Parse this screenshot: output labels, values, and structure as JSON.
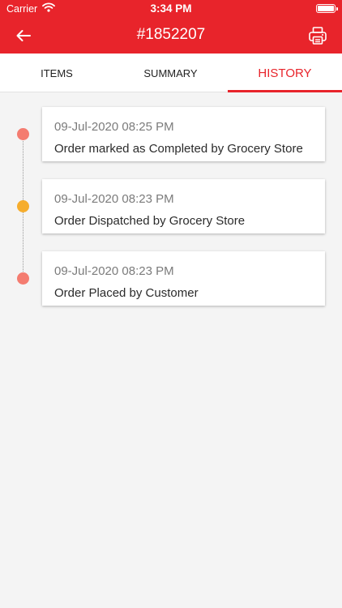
{
  "status_bar": {
    "carrier": "Carrier",
    "time": "3:34 PM"
  },
  "nav": {
    "title": "#1852207",
    "back_icon": "arrow-left-icon",
    "print_icon": "printer-icon"
  },
  "tabs": [
    {
      "label": "ITEMS",
      "active": false
    },
    {
      "label": "SUMMARY",
      "active": false
    },
    {
      "label": "HISTORY",
      "active": true
    }
  ],
  "history": [
    {
      "time": "09-Jul-2020 08:25 PM",
      "text": "Order marked as Completed by Grocery Store",
      "dot_color": "#f47c70"
    },
    {
      "time": "09-Jul-2020 08:23 PM",
      "text": "Order Dispatched by Grocery Store",
      "dot_color": "#f6ad2c"
    },
    {
      "time": "09-Jul-2020 08:23 PM",
      "text": "Order Placed by Customer",
      "dot_color": "#f47c70"
    }
  ],
  "colors": {
    "accent": "#e8242b",
    "background": "#f4f4f4"
  }
}
